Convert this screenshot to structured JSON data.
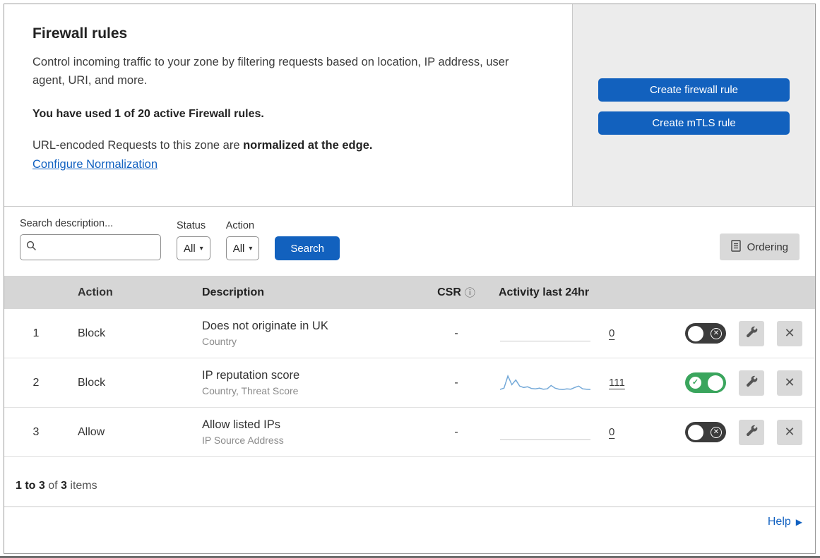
{
  "colors": {
    "accent_blue": "#1261be",
    "toggle_green": "#3aa55d",
    "panel_gray": "#ececec",
    "table_header_gray": "#d6d6d6",
    "sparkline_blue": "#74a9d8"
  },
  "header": {
    "title": "Firewall rules",
    "description": "Control incoming traffic to your zone by filtering requests based on location, IP address, user agent, URI, and more.",
    "usage": "You have used 1 of 20 active Firewall rules.",
    "norm_prefix": "URL-encoded Requests to this zone are ",
    "norm_bold": "normalized at the edge.",
    "norm_link": "Configure Normalization",
    "buttons": {
      "create_firewall": "Create firewall rule",
      "create_mtls": "Create mTLS rule"
    }
  },
  "filters": {
    "search_label": "Search description...",
    "status_label": "Status",
    "status_value": "All",
    "action_label": "Action",
    "action_value": "All",
    "search_button": "Search",
    "ordering_button": "Ordering"
  },
  "table": {
    "columns": {
      "action": "Action",
      "description": "Description",
      "csr": "CSR",
      "activity": "Activity last 24hr"
    },
    "rows": [
      {
        "priority": "1",
        "action": "Block",
        "title": "Does not originate in UK",
        "subtitle": "Country",
        "csr": "-",
        "count": "0",
        "enabled": false
      },
      {
        "priority": "2",
        "action": "Block",
        "title": "IP reputation score",
        "subtitle": "Country, Threat Score",
        "csr": "-",
        "count": "111",
        "enabled": true
      },
      {
        "priority": "3",
        "action": "Allow",
        "title": "Allow listed IPs",
        "subtitle": "IP Source Address",
        "csr": "-",
        "count": "0",
        "enabled": false
      }
    ]
  },
  "footer": {
    "range": "1 to 3",
    "of": " of ",
    "total": "3",
    "items": " items"
  },
  "help": {
    "label": "Help"
  },
  "chart_data": {
    "type": "line",
    "title": "Activity last 24hr (rule 2 sparkline)",
    "values": [
      6,
      10,
      46,
      20,
      34,
      16,
      12,
      14,
      9,
      8,
      10,
      7,
      8,
      18,
      10,
      7,
      6,
      8,
      7,
      12,
      16,
      8,
      7,
      6
    ],
    "total_shown": 111
  }
}
